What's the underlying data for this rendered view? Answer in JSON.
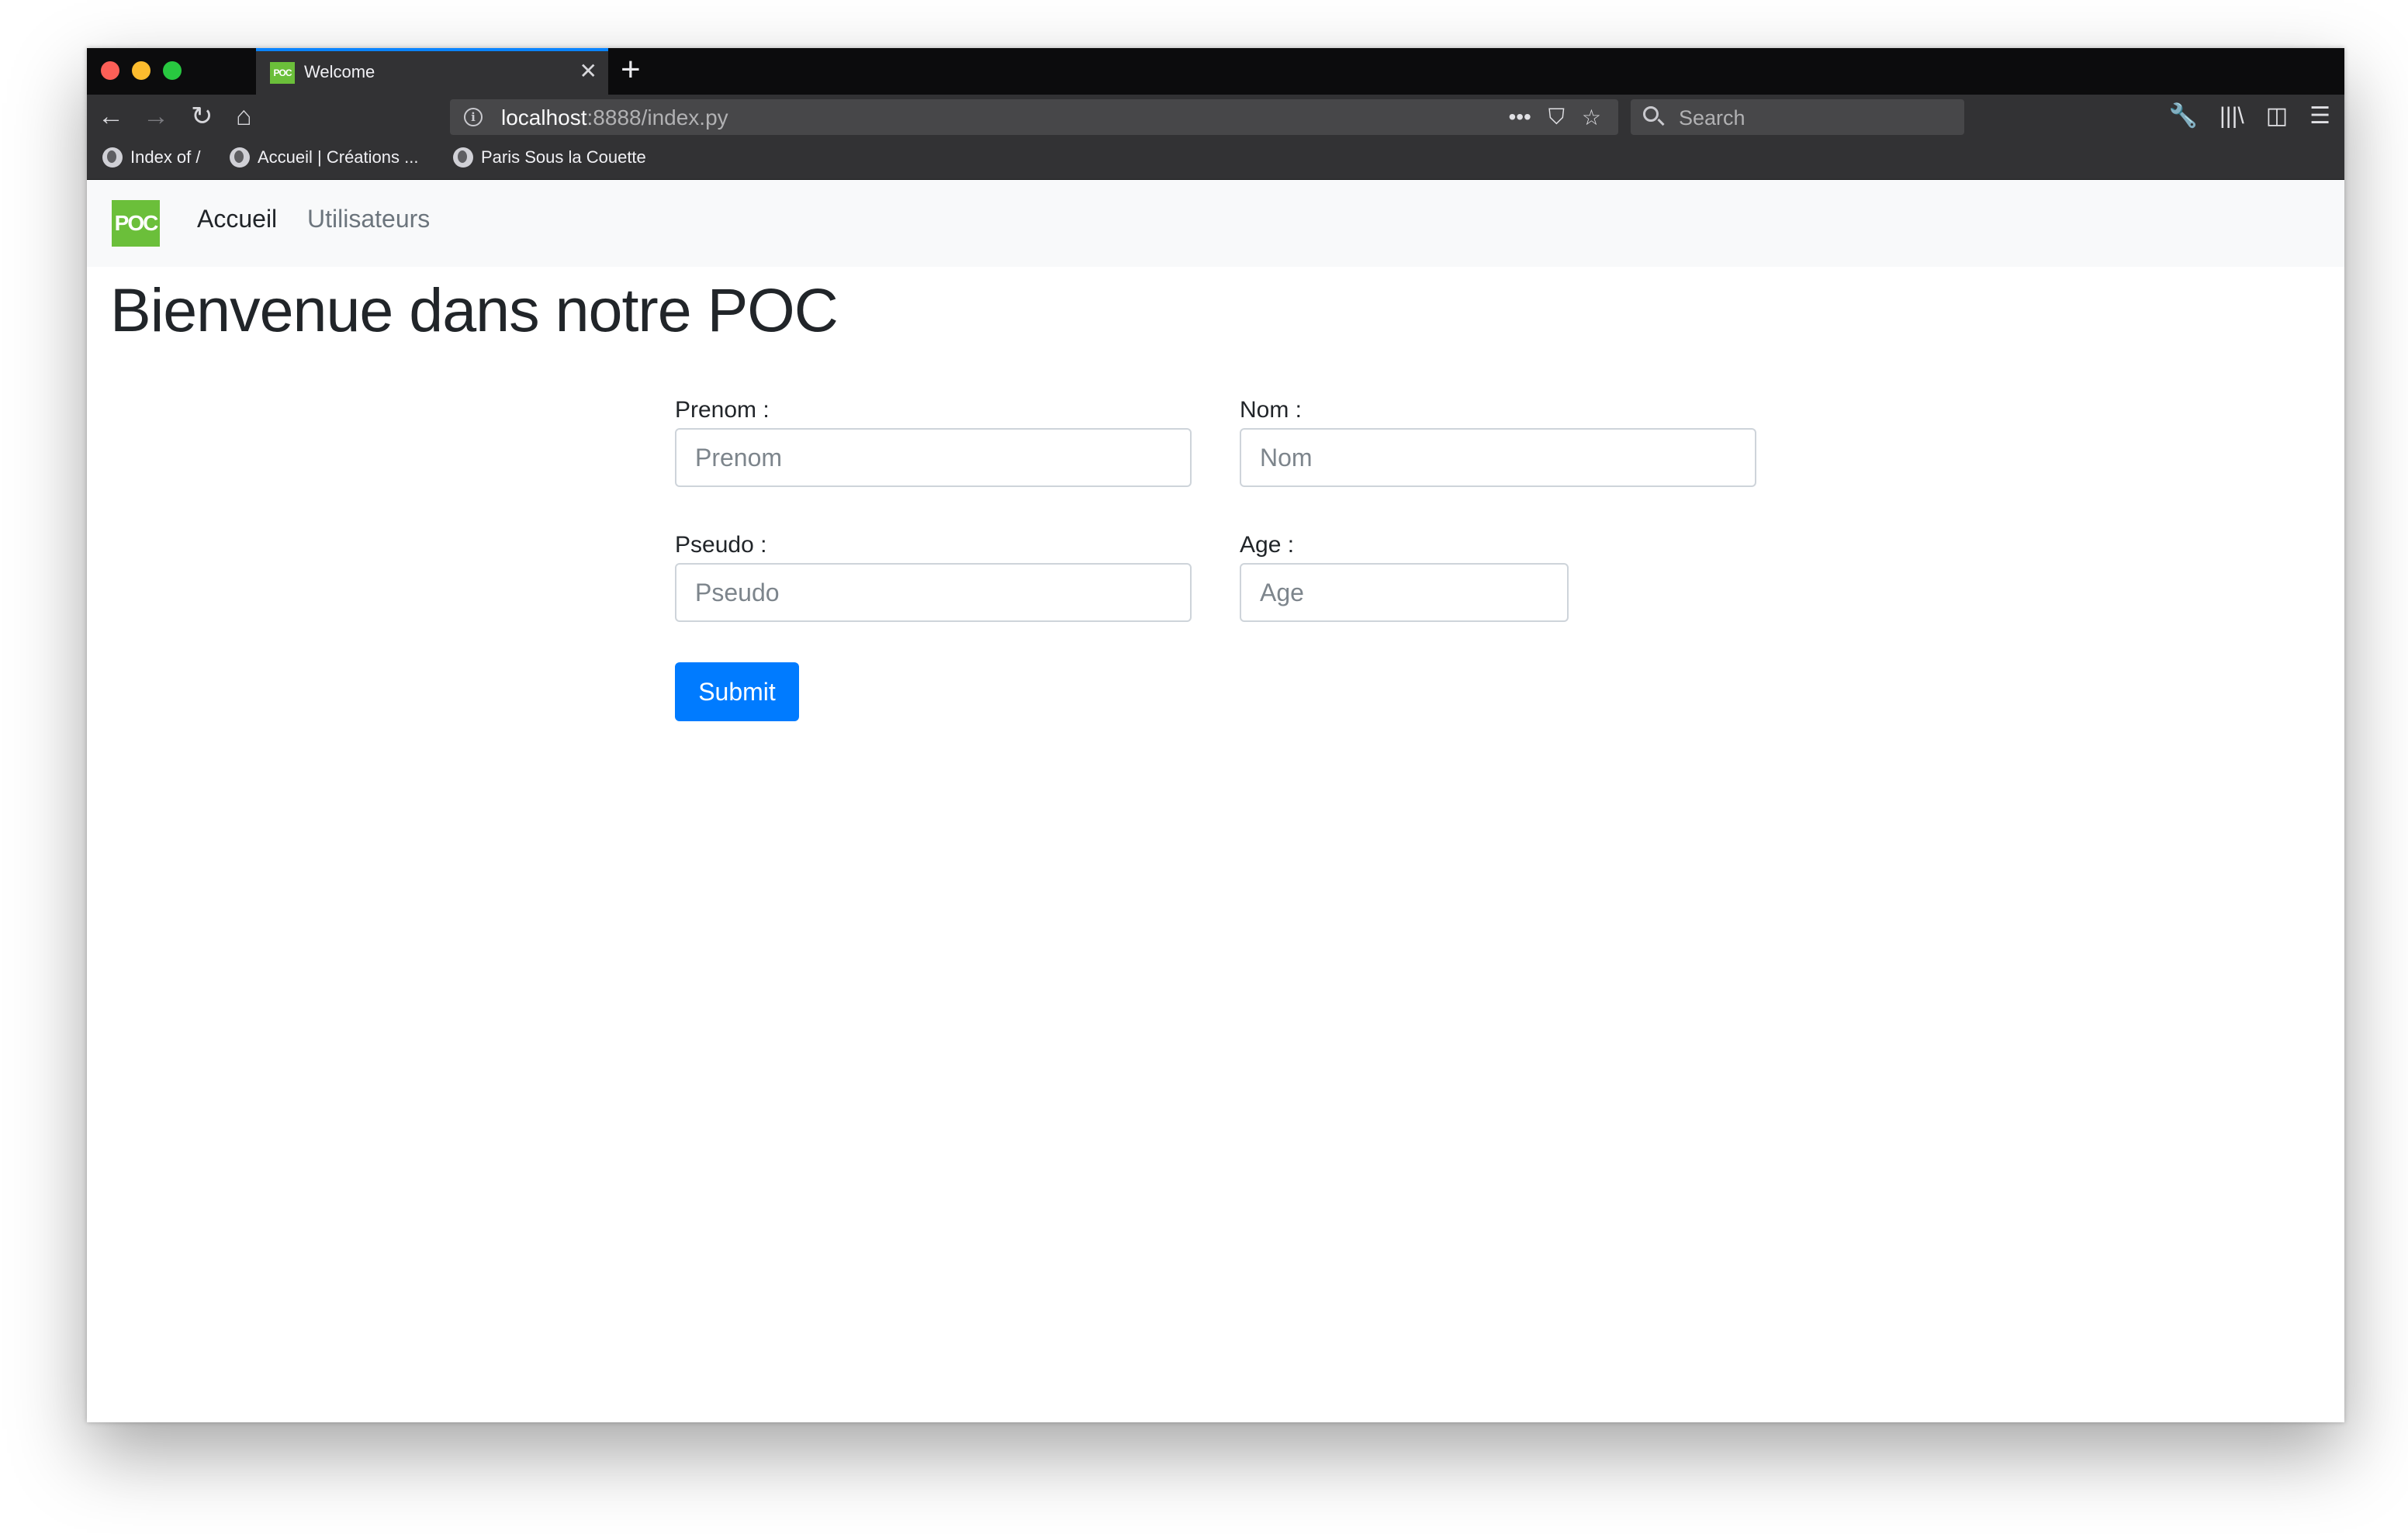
{
  "browser": {
    "tab": {
      "favicon_text": "POC",
      "title": "Welcome",
      "close": "✕"
    },
    "new_tab": "+",
    "nav": {
      "back": "←",
      "forward": "→",
      "reload": "↻",
      "home": "⌂"
    },
    "url": {
      "host": "localhost",
      "rest": ":8888/index.py"
    },
    "url_actions": {
      "more": "•••",
      "pocket": "⛉",
      "bookmark": "☆"
    },
    "search_placeholder": "Search",
    "toolbar": {
      "tools": "🔧",
      "library": "|||\\",
      "sidebar": "◫",
      "menu": "☰"
    },
    "bookmarks": [
      {
        "label": "Index of /"
      },
      {
        "label": "Accueil | Créations ..."
      },
      {
        "label": "Paris Sous la Couette"
      }
    ]
  },
  "site": {
    "brand": "POC",
    "nav_links": [
      {
        "label": "Accueil",
        "active": true
      },
      {
        "label": "Utilisateurs",
        "active": false
      }
    ],
    "title": "Bienvenue dans notre POC"
  },
  "form": {
    "prenom": {
      "label": "Prenom :",
      "placeholder": "Prenom"
    },
    "nom": {
      "label": "Nom :",
      "placeholder": "Nom"
    },
    "pseudo": {
      "label": "Pseudo :",
      "placeholder": "Pseudo"
    },
    "age": {
      "label": "Age :",
      "placeholder": "Age"
    },
    "submit_label": "Submit"
  },
  "colors": {
    "brand_green": "#6bbf3a",
    "primary_blue": "#007bff",
    "tab_accent": "#0a84ff"
  }
}
